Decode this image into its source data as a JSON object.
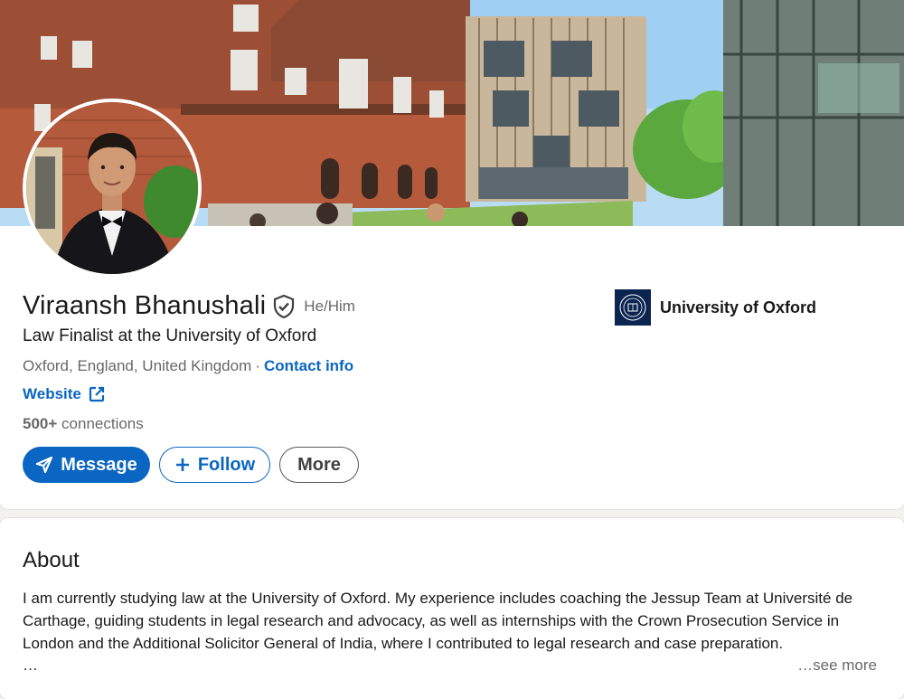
{
  "profile": {
    "name": "Viraansh Bhanushali",
    "pronouns": "He/Him",
    "headline": "Law Finalist at the University of Oxford",
    "location": "Oxford, England, United Kingdom",
    "separator": "·",
    "contact_info_label": "Contact info",
    "website_label": "Website",
    "connections_count": "500+",
    "connections_label": "connections"
  },
  "actions": {
    "message_label": "Message",
    "follow_label": "Follow",
    "more_label": "More"
  },
  "education": {
    "school_name": "University of Oxford"
  },
  "about": {
    "title": "About",
    "text": "I am currently studying law at the University of Oxford. My experience includes coaching the Jessup Team at Université de Carthage, guiding students in legal research and advocacy, as well as internships with the Crown Prosecution Service in London and the Additional Solicitor General of India, where I contributed to legal research and case preparation.",
    "ellipsis": "…",
    "see_more_label": "…see more"
  },
  "colors": {
    "accent": "#0a66c2",
    "school_logo_bg": "#0b2550"
  },
  "icons": [
    "verified-shield-icon",
    "external-link-icon",
    "send-icon",
    "plus-icon",
    "oxford-crest-icon"
  ]
}
